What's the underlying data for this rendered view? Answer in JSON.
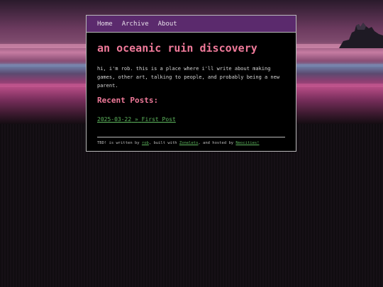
{
  "nav": {
    "items": [
      {
        "label": "Home"
      },
      {
        "label": "Archive"
      },
      {
        "label": "About"
      }
    ]
  },
  "site": {
    "title": "an oceanic ruin discovery",
    "intro": "hi, i'm rob. this is a place where i'll write about making games, other art, talking to people, and probably being a new parent."
  },
  "recent": {
    "heading": "Recent Posts:",
    "posts": [
      {
        "date": "2025-03-22",
        "separator": "»",
        "title": "First Post"
      }
    ]
  },
  "footer": {
    "prefix": "TBD! is written by ",
    "author": "rob",
    "middle": ", built with ",
    "builder": "Zonelets",
    "suffix": ", and hosted by ",
    "host": "Neocities!"
  },
  "colors": {
    "accent": "#f07a9a",
    "link": "#5fb85f",
    "nav_bg": "#5b2a6d",
    "panel_bg": "#000000",
    "border": "#b9b9b9"
  }
}
